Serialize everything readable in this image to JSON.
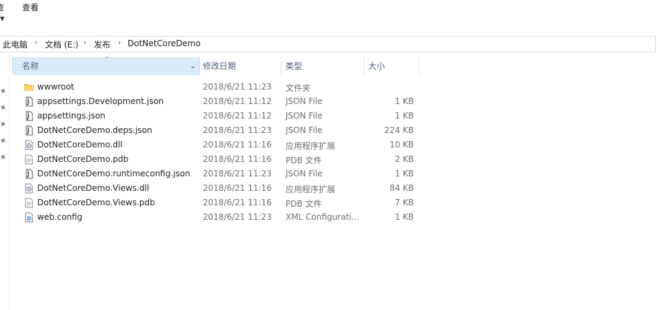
{
  "menu": {
    "items": [
      "查看"
    ],
    "partial_left": "查"
  },
  "ribbon": {
    "chevron": "▾"
  },
  "breadcrumb": {
    "items": [
      "此电脑",
      "文档 (E:)",
      "发布",
      "DotNetCoreDemo"
    ],
    "separator": "›"
  },
  "columns": {
    "name": "名称",
    "date": "修改日期",
    "type": "类型",
    "size": "大小",
    "sort_indicator": "^",
    "dropdown": "⌄"
  },
  "files": [
    {
      "name": "wwwroot",
      "date": "2018/6/21 11:23",
      "type": "文件夹",
      "size": "",
      "icon": "folder-icon"
    },
    {
      "name": "appsettings.Development.json",
      "date": "2018/6/21 11:12",
      "type": "JSON File",
      "size": "1 KB",
      "icon": "json-file-icon"
    },
    {
      "name": "appsettings.json",
      "date": "2018/6/21 11:12",
      "type": "JSON File",
      "size": "1 KB",
      "icon": "json-file-icon"
    },
    {
      "name": "DotNetCoreDemo.deps.json",
      "date": "2018/6/21 11:23",
      "type": "JSON File",
      "size": "224 KB",
      "icon": "json-file-icon"
    },
    {
      "name": "DotNetCoreDemo.dll",
      "date": "2018/6/21 11:16",
      "type": "应用程序扩展",
      "size": "10 KB",
      "icon": "dll-file-icon"
    },
    {
      "name": "DotNetCoreDemo.pdb",
      "date": "2018/6/21 11:16",
      "type": "PDB 文件",
      "size": "2 KB",
      "icon": "pdb-file-icon"
    },
    {
      "name": "DotNetCoreDemo.runtimeconfig.json",
      "date": "2018/6/21 11:23",
      "type": "JSON File",
      "size": "1 KB",
      "icon": "json-file-icon"
    },
    {
      "name": "DotNetCoreDemo.Views.dll",
      "date": "2018/6/21 11:16",
      "type": "应用程序扩展",
      "size": "84 KB",
      "icon": "dll-file-icon"
    },
    {
      "name": "DotNetCoreDemo.Views.pdb",
      "date": "2018/6/21 11:16",
      "type": "PDB 文件",
      "size": "7 KB",
      "icon": "pdb-file-icon"
    },
    {
      "name": "web.config",
      "date": "2018/6/21 11:23",
      "type": "XML Configurati...",
      "size": "1 KB",
      "icon": "config-file-icon"
    }
  ],
  "colors": {
    "header_selected": "#d9ebf9",
    "header_text": "#4c607a",
    "folder": "#f7d36b",
    "secondary_text": "#6d6d6d"
  }
}
